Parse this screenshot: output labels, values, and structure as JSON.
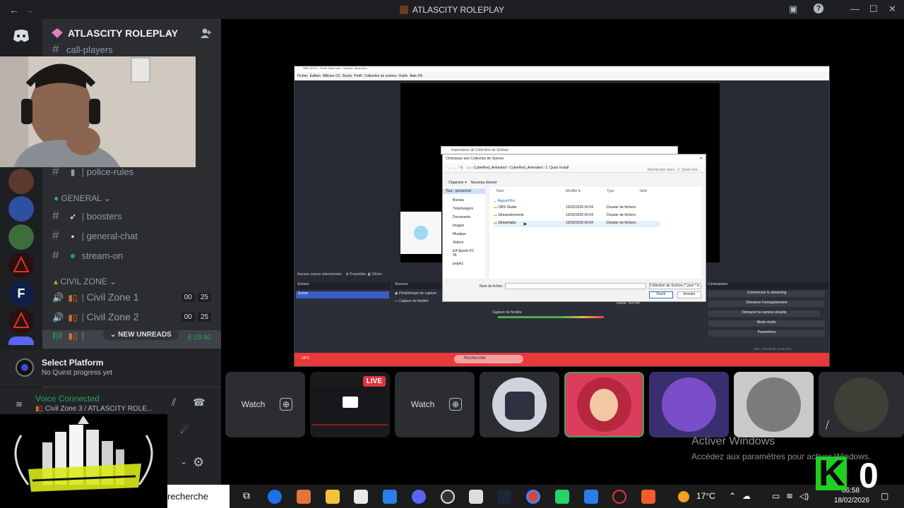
{
  "window": {
    "title": "ATLASCITY ROLEPLAY",
    "back": "←",
    "forward": "→",
    "minimize": "—",
    "maximize": "☐",
    "close": "✕",
    "help": "?"
  },
  "server": {
    "name": "ATLASCITY ROLEPLAY"
  },
  "channels": {
    "partial_top": "call-players",
    "police_rules": "police-rules",
    "category_general": "GENERAL",
    "boosters": "boosters",
    "general_chat": "general-chat",
    "stream_on": "stream-on",
    "category_civil": "CIVIL ZONE",
    "civil1": "Civil Zone 1",
    "civil1_a": "00",
    "civil1_b": "25",
    "civil2": "Civil Zone 2",
    "civil2_a": "00",
    "civil2_b": "25",
    "civil3_time": "6:19:40",
    "new_unreads": "NEW UNREADS"
  },
  "quest": {
    "title": "Select Platform",
    "subtitle": "No Quest progress yet"
  },
  "voice": {
    "status": "Voice Connected",
    "location": "Civil Zone 3 / ATLASCITY ROLE..."
  },
  "streams": {
    "watch_label": "Watch",
    "live_label": "LIVE"
  },
  "obs": {
    "title": "OBS 32.0.4 - Profil: Sans nom - Scènes: Sans nom",
    "menu": [
      "Fichier",
      "Édition",
      "Afficher (V)",
      "Docks",
      "Profil",
      "Collection de scènes",
      "Outils",
      "Aide (H)"
    ],
    "scenes_header": "Scènes",
    "scene_item": "Scène",
    "sources_header": "Sources",
    "source_1": "Périphérique de capture",
    "source_2": "Capture de fenêtre",
    "no_source": "Aucune source sélectionnée",
    "properties": "Propriétés",
    "filters": "Filtres",
    "audio_capture": "Capture de fenêtre",
    "duration_label": "Durée",
    "duration_value": "300 ms",
    "controls_header": "Commandes",
    "controls": [
      "Commencer le streaming",
      "Démarrer l'enregistrement",
      "Démarrer la caméra virtuelle",
      "Mode studio",
      "Paramètres"
    ],
    "status": "CPU: 1.9%   30.00 / 30.00 FPS"
  },
  "dialog": {
    "parent_title": "Importateur de Collection de Scènes",
    "title": "Choisissez une Collection de Scènes",
    "path": [
      "CyberRed_Animated",
      "CyberRed_Animated",
      "2. Quick Install"
    ],
    "search_placeholder": "Rechercher dans : 2. Quick Inst...",
    "organize": "Organiser",
    "new_folder": "Nouveau dossier",
    "nav_items": [
      "Tout - personnel",
      "Bureau",
      "Téléchargem",
      "Documents",
      "Images",
      "Musique",
      "Vidéos",
      "EA Sports FC 26",
      "projet1"
    ],
    "columns": [
      "Nom",
      "Modifié le",
      "Type",
      "Taille"
    ],
    "group": "Aujourd'hui",
    "rows": [
      {
        "name": "OBS Studio",
        "date": "10/02/2026 06:54",
        "type": "Dossier de fichiers"
      },
      {
        "name": "Streamelements",
        "date": "10/02/2026 06:54",
        "type": "Dossier de fichiers"
      },
      {
        "name": "Streamlabs",
        "date": "10/02/2026 06:54",
        "type": "Dossier de fichiers"
      }
    ],
    "filename_label": "Nom du fichier :",
    "filter": "Collection de Scènes (*.json *.b...",
    "open": "Ouvrir",
    "cancel": "Annuler"
  },
  "obs_taskbar": {
    "search": "Rechercher",
    "weather": "18°C"
  },
  "activate": {
    "title": "Activer Windows",
    "subtitle": "Accédez aux paramètres pour activer Windows."
  },
  "taskbar": {
    "search": "recherche",
    "temp": "17°C",
    "time": "06:58",
    "date": "18/02/2026",
    "overlay_digit": "0"
  }
}
